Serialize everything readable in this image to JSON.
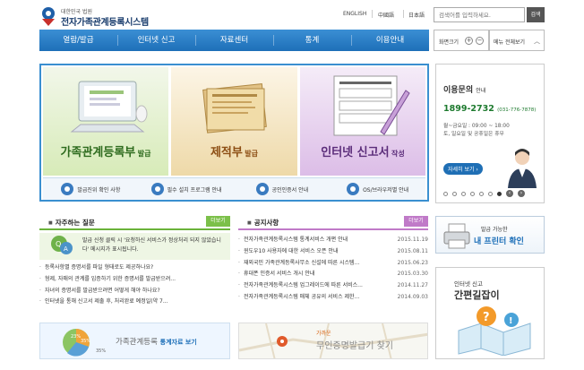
{
  "header": {
    "logo_sub": "대한민국 법원",
    "logo_title": "전자가족관계등록시스템",
    "languages": [
      "ENGLISH",
      "中國語",
      "日本語"
    ],
    "search_placeholder": "검색어를 입력하세요.",
    "search_button": "검색"
  },
  "nav": {
    "items": [
      "열람/발급",
      "인터넷 신고",
      "자료센터",
      "통계",
      "이용안내"
    ],
    "screen_size_label": "화면크기",
    "menu_all_label": "메뉴 전체보기"
  },
  "banner": {
    "panels": [
      {
        "title": "가족관계등록부",
        "suffix": "발급"
      },
      {
        "title": "제적부",
        "suffix": "발급"
      },
      {
        "title": "인터넷 신고서",
        "suffix": "작성"
      }
    ],
    "bottom_links": [
      "발급진위 확인 사항",
      "필수 설치 프로그램 안내",
      "공인인증서 안내",
      "OS/브라우저별 안내"
    ]
  },
  "contact": {
    "title": "이용문의",
    "title_suffix": "안내",
    "phone": "1899-2732",
    "phone_alt": "(031-776-7878)",
    "hours_line1": "월~금요일 : 09:00 ~ 18:00",
    "hours_line2": "토, 일요일 및 공휴일은 휴무",
    "detail_button": "자세히 보기 ›",
    "pager_prev": "‹",
    "pager_next": "›"
  },
  "faq": {
    "title": "자주하는 질문",
    "more": "더보기",
    "highlight": "발급 신청 클릭 시 '요청하신 서비스가 정상처리 되지 않았습니다' 메시지가 표시됩니다.",
    "items": [
      "등록사항별 증명서를 파일 형태로도 제공하나요?",
      "형제, 자매의 관계를 입증하기 위한 증명서를 발급받으려...",
      "자녀의 증명서를 발급받으려면 어떻게 해야 하나요?",
      "인터넷을 통해 신고서 제출 후, 처리완료 예정일(약 7..."
    ]
  },
  "notice": {
    "title": "공지사항",
    "more": "더보기",
    "items": [
      {
        "title": "전자가족관계등록시스템 통계서비스 개편 안내",
        "date": "2015.11.19"
      },
      {
        "title": "윈도우10 사용자에 대한 서비스 오픈 안내",
        "date": "2015.08.11"
      },
      {
        "title": "재외국민 가족관계등록사무소 신설에 따른 시스템...",
        "date": "2015.06.23"
      },
      {
        "title": "휴대폰 인증서 서비스 개시 안내",
        "date": "2015.03.30"
      },
      {
        "title": "전자가족관계등록시스템 업그레이드에 따른 서비스...",
        "date": "2014.11.27"
      },
      {
        "title": "전자가족관계등록시스템 매체 공유의 서비스 제한...",
        "date": "2014.09.03"
      }
    ]
  },
  "printer": {
    "line1": "발급 가능한",
    "line2": "내 프린터 확인"
  },
  "guide": {
    "line1": "인터넷 신고",
    "line2": "간편길잡이"
  },
  "stat_banner": {
    "pie_labels": [
      "23%",
      "35%",
      "35%"
    ],
    "text": "가족관계등록",
    "text_bold": "통계자료 보기"
  },
  "map_banner": {
    "pre": "가까운",
    "text": "무인증명발급기 찾기"
  }
}
